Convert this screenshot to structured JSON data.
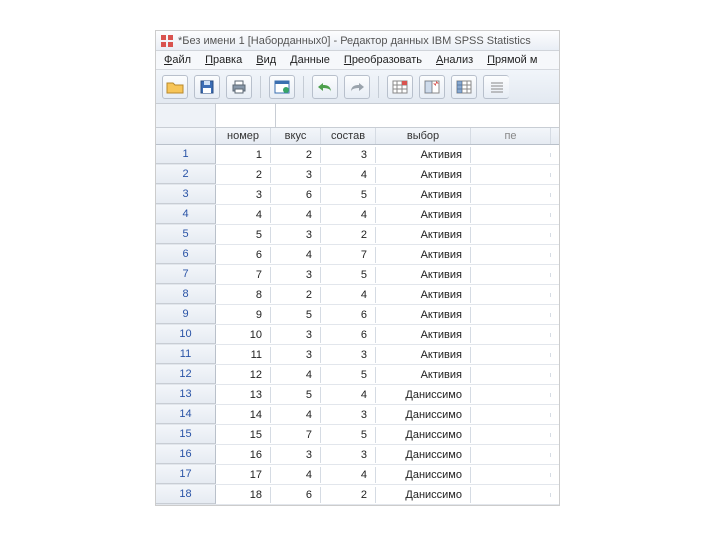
{
  "window": {
    "title": "*Без имени 1 [Наборданных0] - Редактор данных IBM SPSS Statistics"
  },
  "menu": {
    "file": "Файл",
    "edit": "Правка",
    "view": "Вид",
    "data": "Данные",
    "transform": "Преобразовать",
    "analyze": "Анализ",
    "direct": "Прямой м"
  },
  "columns": {
    "row": "",
    "nomer": "номер",
    "vkus": "вкус",
    "sostav": "состав",
    "vybor": "выбор",
    "extra": "пе"
  },
  "rows": [
    {
      "n": "1",
      "nomer": "1",
      "vkus": "2",
      "sostav": "3",
      "vybor": "Активия"
    },
    {
      "n": "2",
      "nomer": "2",
      "vkus": "3",
      "sostav": "4",
      "vybor": "Активия"
    },
    {
      "n": "3",
      "nomer": "3",
      "vkus": "6",
      "sostav": "5",
      "vybor": "Активия"
    },
    {
      "n": "4",
      "nomer": "4",
      "vkus": "4",
      "sostav": "4",
      "vybor": "Активия"
    },
    {
      "n": "5",
      "nomer": "5",
      "vkus": "3",
      "sostav": "2",
      "vybor": "Активия"
    },
    {
      "n": "6",
      "nomer": "6",
      "vkus": "4",
      "sostav": "7",
      "vybor": "Активия"
    },
    {
      "n": "7",
      "nomer": "7",
      "vkus": "3",
      "sostav": "5",
      "vybor": "Активия"
    },
    {
      "n": "8",
      "nomer": "8",
      "vkus": "2",
      "sostav": "4",
      "vybor": "Активия"
    },
    {
      "n": "9",
      "nomer": "9",
      "vkus": "5",
      "sostav": "6",
      "vybor": "Активия"
    },
    {
      "n": "10",
      "nomer": "10",
      "vkus": "3",
      "sostav": "6",
      "vybor": "Активия"
    },
    {
      "n": "11",
      "nomer": "11",
      "vkus": "3",
      "sostav": "3",
      "vybor": "Активия"
    },
    {
      "n": "12",
      "nomer": "12",
      "vkus": "4",
      "sostav": "5",
      "vybor": "Активия"
    },
    {
      "n": "13",
      "nomer": "13",
      "vkus": "5",
      "sostav": "4",
      "vybor": "Даниссимо"
    },
    {
      "n": "14",
      "nomer": "14",
      "vkus": "4",
      "sostav": "3",
      "vybor": "Даниссимо"
    },
    {
      "n": "15",
      "nomer": "15",
      "vkus": "7",
      "sostav": "5",
      "vybor": "Даниссимо"
    },
    {
      "n": "16",
      "nomer": "16",
      "vkus": "3",
      "sostav": "3",
      "vybor": "Даниссимо"
    },
    {
      "n": "17",
      "nomer": "17",
      "vkus": "4",
      "sostav": "4",
      "vybor": "Даниссимо"
    },
    {
      "n": "18",
      "nomer": "18",
      "vkus": "6",
      "sostav": "2",
      "vybor": "Даниссимо"
    }
  ]
}
